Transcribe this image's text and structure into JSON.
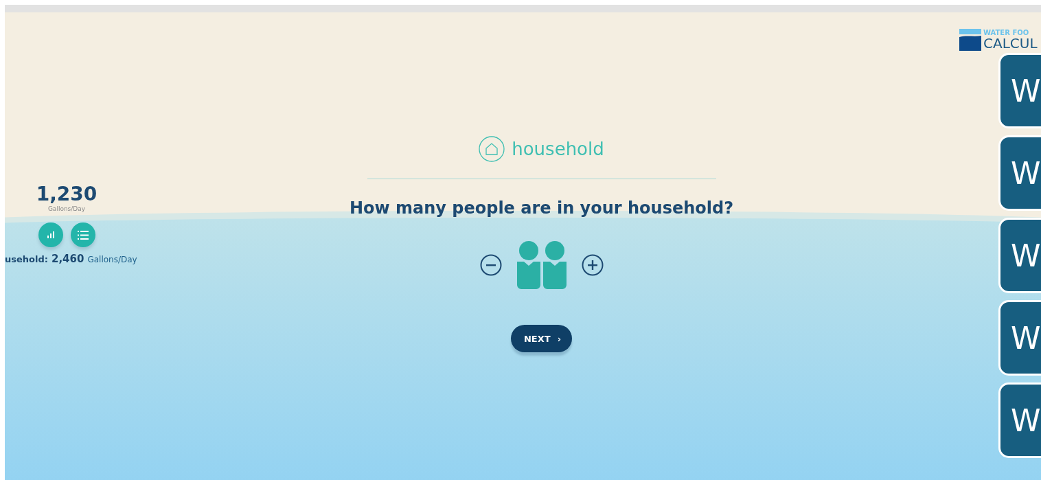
{
  "logo": {
    "line_1": "WATER FOO",
    "line_2": "CALCUL"
  },
  "summary": {
    "total": "1,230",
    "unit": "Gallons/Day",
    "household_label": "usehold:",
    "household_total": "2,460",
    "household_unit": "Gallons/Day"
  },
  "section": {
    "title": "household"
  },
  "question": "How many people are in your household?",
  "people": [
    {
      "kind": "person"
    },
    {
      "kind": "person"
    }
  ],
  "next_button": {
    "label": "NEXT",
    "arrow": "›"
  },
  "side_tiles": [
    {
      "label": "W"
    },
    {
      "label": "W"
    },
    {
      "label": "W"
    },
    {
      "label": "W"
    },
    {
      "label": "W"
    }
  ]
}
